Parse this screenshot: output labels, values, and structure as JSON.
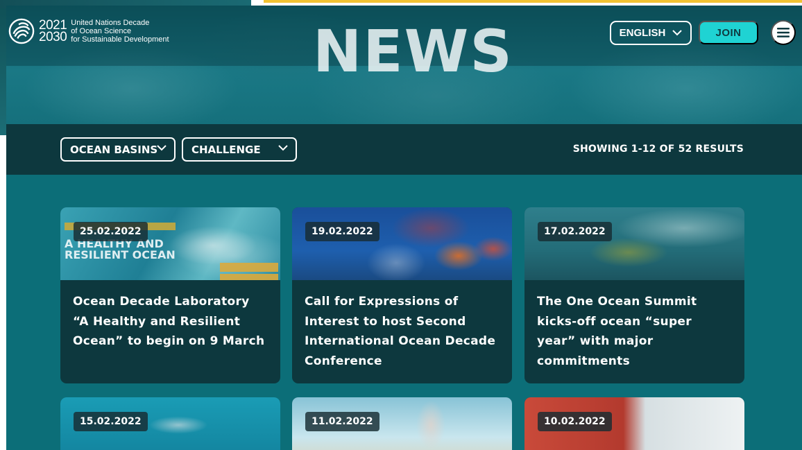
{
  "hero": {
    "title": "NEWS"
  },
  "logo": {
    "years_top": "2021",
    "years_bottom": "2030",
    "line1": "United Nations Decade",
    "line2": "of Ocean Science",
    "line3": "for Sustainable Development"
  },
  "header": {
    "language_label": "ENGLISH",
    "join_label": "JOIN"
  },
  "filters": {
    "basins_label": "OCEAN BASINS",
    "challenge_label": "CHALLENGE",
    "results_text": "SHOWING 1-12 OF 52 RESULTS"
  },
  "cards": [
    {
      "date": "25.02.2022",
      "title": "Ocean Decade Laboratory “A Healthy and Resilient Ocean” to begin on 9 March"
    },
    {
      "date": "19.02.2022",
      "title": "Call for Expressions of Interest to host Second International Ocean Decade Conference"
    },
    {
      "date": "17.02.2022",
      "title": "The One Ocean Summit kicks-off ocean “super year” with major commitments"
    },
    {
      "date": "15.02.2022",
      "title": ""
    },
    {
      "date": "11.02.2022",
      "title": ""
    },
    {
      "date": "10.02.2022",
      "title": ""
    }
  ],
  "card1_image_text": {
    "line1": "A HEALTHY AND",
    "line2": "RESILIENT OCEAN"
  },
  "colors": {
    "accent": "#1fd3d3",
    "header_dark": "#0d383e",
    "content_bg": "#0c6e78"
  },
  "icons": [
    "decade-logo-icon",
    "chevron-down-icon",
    "menu-icon"
  ]
}
